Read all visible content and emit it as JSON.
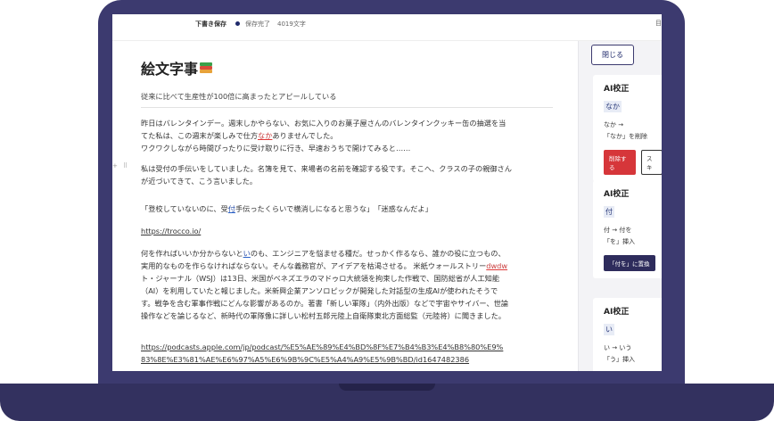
{
  "topbar": {
    "draft_label": "下書き保存",
    "saved_label": "保存完了",
    "char_count": "4019文字",
    "edge_glyph": "目"
  },
  "document": {
    "title": "絵文字事",
    "subtitle": "従来に比べて生産性が100倍に高まったとアピールしている",
    "p1": {
      "l1": "昨日はバレンタインデー。週末しかやらない、お気に入りのお菓子屋さんのバレンタインクッキー缶の抽選を当",
      "l2_a": "てた私は、この週末が楽しみで仕方",
      "l2_mark": "なか",
      "l2_b": "ありませんでした。",
      "l3": "ワクワクしながら時間ぴったりに受け取りに行き、早速おうちで開けてみると……"
    },
    "p2": {
      "l1": "私は受付の手伝いをしていました。名簿を見て、来場者の名前を確認する役です。そこへ、クラスの子の親御さん",
      "l2": "が近づいてきて、こう言いました。"
    },
    "p3": {
      "a": "「登校していないのに、受",
      "mark": "付",
      "b": "手伝ったくらいで横消しになると思うな」　「迷惑なんだよ」"
    },
    "link1": "https://trocco.io/",
    "p4": {
      "l1_a": "何を作ればいいか分からないと",
      "l1_mark": "い",
      "l1_b": "のも、エンジニアを悩ませる種だ。せっかく作るなら、誰かの役に立つもの、",
      "l2_a": "実用的なものを作らなければならない。そんな義務官が、アイデアを枯渇させる。 米紙ウォールストリー",
      "l2_mark": "dwdw",
      "l3": "ト・ジャーナル（WSJ）は13日、米国がベネズエラのマドゥロ大統領を拘束した作戦で、国防総省が人工知能",
      "l4": "（AI）を利用していたと報じました。米新興企業アンソロピックが開発した対話型の生成AIが使われたそうで",
      "l5": "す。戦争を含む軍事作戦にどんな影響があるのか。著書「新しい軍隊」（内外出版）などで宇宙やサイバー、世論",
      "l6": "操作などを論じるなど、新時代の軍隊像に詳しい松村五郎元陸上自衛隊東北方面総監（元陸将）に聞きました。"
    },
    "link2": {
      "l1": "https://podcasts.apple.com/jp/podcast/%E5%AE%89%E4%BD%8F%E7%B4%B3%E4%B8%80%E9%",
      "l2": "83%8E%E3%81%AE%E6%97%A5%E6%9B%9C%E5%A4%A9%E5%9B%BD/id1647482386"
    }
  },
  "sidebar": {
    "close_label": "閉じる",
    "cards": [
      {
        "title": "AI校正",
        "chip": "なか",
        "line1": "なか →",
        "line2": "「なか」を削除",
        "button1": "削除する",
        "button2": "スキ"
      },
      {
        "title": "AI校正",
        "chip": "付",
        "line1": "付 → 付を",
        "line2": "「を」挿入",
        "button1": "「付を」に置換"
      },
      {
        "title": "AI校正",
        "chip": "い",
        "line1": "い → いう",
        "line2": "「う」挿入"
      }
    ]
  },
  "colors": {
    "frame": "#3c3a6f",
    "accent_navy": "#2e2c5c",
    "delete_red": "#d6363a",
    "mark_blue": "#2a62c9"
  }
}
